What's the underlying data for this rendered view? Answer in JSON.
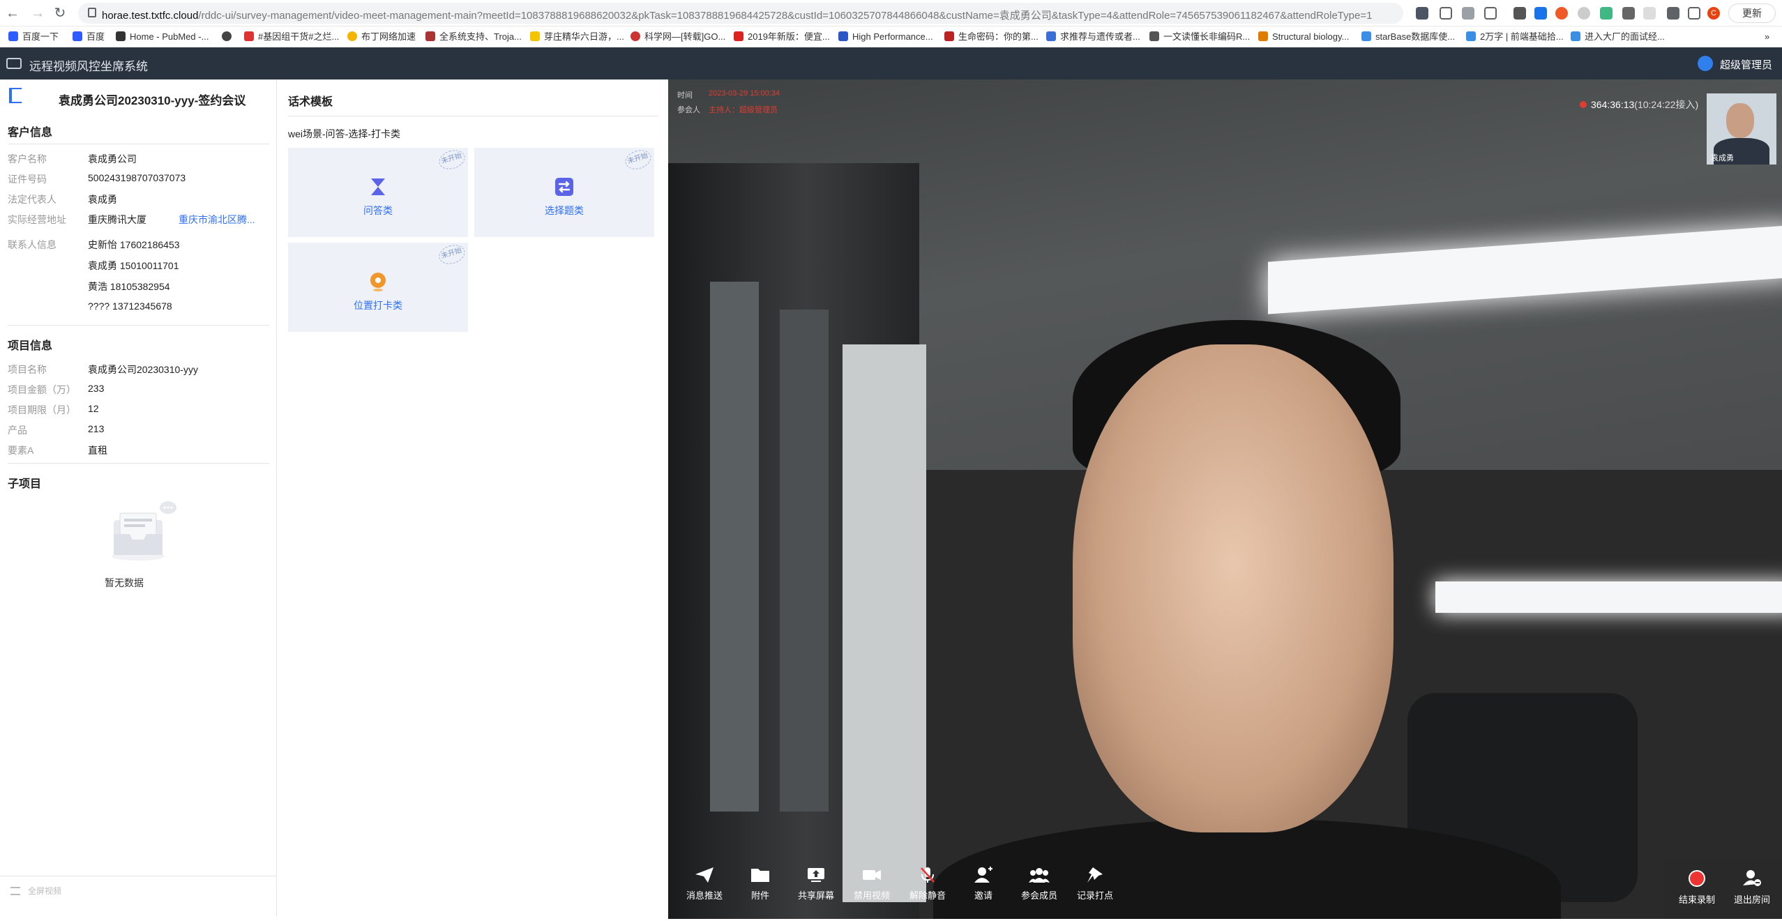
{
  "browser": {
    "url_host": "horae.test.txtfc.cloud",
    "url_path": "/rddc-ui/survey-management/video-meet-management-main?meetId=1083788819688620032&pkTask=1083788819684425728&custId=1060325707844866048&custName=袁成勇公司&taskType=4&attendRole=7456575390611824​67&attendRoleType=1",
    "update_label": "更新",
    "profile_initial": "C",
    "bookmarks": [
      "百度一下",
      "百度",
      "Home - PubMed -...",
      "#基因组干货#之烂...",
      "布丁网络加速",
      "全系统支持、Troja...",
      "芽庄精华六日游，...",
      "科学网—[转载]GO...",
      "2019年新版：便宜...",
      "High Performance...",
      "生命密码：你的第...",
      "求推荐与遗传或者...",
      "一文读懂长非编码R...",
      "Structural biology...",
      "starBase数据库使...",
      "2万字 | 前端基础拾...",
      "进入大厂的面试经..."
    ],
    "more_bookmarks": "»"
  },
  "app": {
    "title": "远程视频风控坐席系统",
    "user": "超级管理员"
  },
  "left": {
    "meeting_title": "袁成勇公司20230310-yyy-签约会议",
    "customer_section": "客户信息",
    "customer": [
      {
        "label": "客户名称",
        "value": "袁成勇公司"
      },
      {
        "label": "证件号码",
        "value": "500243198707037073"
      },
      {
        "label": "法定代表人",
        "value": "袁成勇"
      },
      {
        "label": "实际经营地址",
        "value": "重庆腾讯大厦",
        "link": "重庆市渝北区腾..."
      }
    ],
    "contact_label": "联系人信息",
    "contacts": [
      "史新怡 17602186453",
      "袁成勇 15010011701",
      "黄浩 18105382954",
      "???? 13712345678"
    ],
    "project_section": "项目信息",
    "project": [
      {
        "label": "项目名称",
        "value": "袁成勇公司20230310-yyy"
      },
      {
        "label": "项目金额（万）",
        "value": "233"
      },
      {
        "label": "项目期限（月）",
        "value": "12"
      },
      {
        "label": "产品",
        "value": "213"
      },
      {
        "label": "要素A",
        "value": "直租"
      }
    ],
    "sub_section": "子项目",
    "empty_text": "暂无数据",
    "footer_text": "全屏视频"
  },
  "middle": {
    "title": "话术模板",
    "scene": "wei场景-问答-选择-打卡类",
    "cards": [
      {
        "label": "问答类",
        "stamp": "未开始",
        "color": "#5b63e8"
      },
      {
        "label": "选择题类",
        "stamp": "未开始",
        "color": "#5b63e8"
      },
      {
        "label": "位置打卡类",
        "stamp": "未开始",
        "color": "#f0962a"
      }
    ]
  },
  "video": {
    "time_label": "时间",
    "time_value": "2023-03-29 15:00:34",
    "attendee_label": "参会人",
    "attendee_value": "主持人：超级管理员",
    "rec_duration": "364:36:13",
    "rec_joined": "(10:24:22接入)",
    "thumb_name": "袁成勇",
    "toolbar": [
      "消息推送",
      "附件",
      "共享屏幕",
      "禁用视频",
      "解除静音",
      "邀请",
      "参会成员",
      "记录打点"
    ],
    "end_record": "结束录制",
    "exit_room": "退出房间"
  }
}
